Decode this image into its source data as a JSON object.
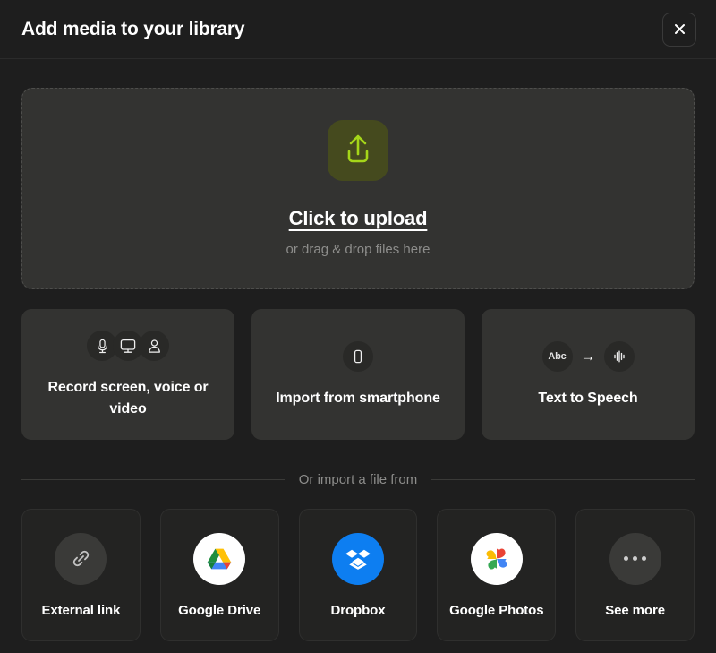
{
  "header": {
    "title": "Add media to your library",
    "close_icon": "close-icon"
  },
  "dropzone": {
    "icon": "upload-arrow-icon",
    "title": "Click to upload",
    "subtitle": "or drag & drop files here",
    "badge_bg": "#454a1e",
    "badge_fg": "#a5d619"
  },
  "action_cards": [
    {
      "label": "Record screen, voice or video",
      "icons": [
        "microphone-icon",
        "monitor-icon",
        "person-icon"
      ]
    },
    {
      "label": "Import from smartphone",
      "icons": [
        "smartphone-icon"
      ]
    },
    {
      "label": "Text to Speech",
      "icons": [
        "abc-text-icon",
        "arrow-right-icon",
        "audio-waveform-icon"
      ],
      "abc_label": "Abc",
      "arrow": "→"
    }
  ],
  "divider": {
    "text": "Or import a file from"
  },
  "services": [
    {
      "label": "External link",
      "icon": "link-icon",
      "style": "grey"
    },
    {
      "label": "Google Drive",
      "icon": "google-drive-icon",
      "style": "white"
    },
    {
      "label": "Dropbox",
      "icon": "dropbox-icon",
      "style": "blue"
    },
    {
      "label": "Google Photos",
      "icon": "google-photos-icon",
      "style": "white"
    },
    {
      "label": "See more",
      "icon": "ellipsis-icon",
      "style": "grey"
    }
  ],
  "colors": {
    "page_bg": "#1e1e1e",
    "panel_bg": "#333331",
    "tile_bg": "#232322",
    "accent_green": "#a5d619",
    "dropbox_blue": "#0d7ef1",
    "text_primary": "#ffffff",
    "text_muted": "#8d8d8b"
  }
}
